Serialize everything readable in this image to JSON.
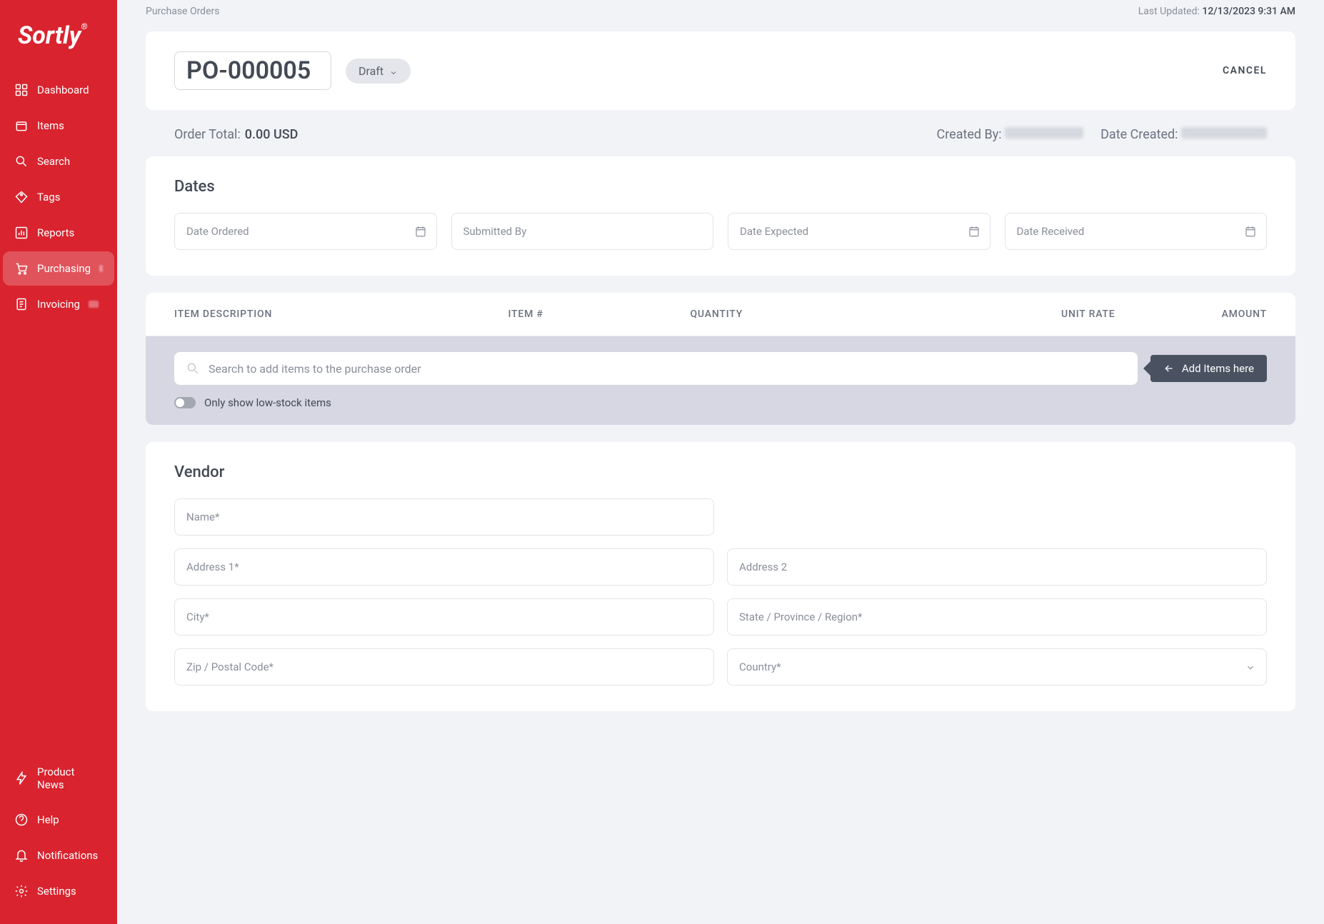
{
  "brand": "Sortly",
  "sidebar": {
    "top": [
      {
        "label": "Dashboard",
        "icon": "dashboard"
      },
      {
        "label": "Items",
        "icon": "box"
      },
      {
        "label": "Search",
        "icon": "search"
      },
      {
        "label": "Tags",
        "icon": "tag"
      },
      {
        "label": "Reports",
        "icon": "bar-chart"
      },
      {
        "label": "Purchasing",
        "icon": "cart",
        "active": true,
        "badge": true
      },
      {
        "label": "Invoicing",
        "icon": "document",
        "badge": true
      }
    ],
    "bottom": [
      {
        "label": "Product News",
        "icon": "bolt"
      },
      {
        "label": "Help",
        "icon": "help"
      },
      {
        "label": "Notifications",
        "icon": "bell"
      },
      {
        "label": "Settings",
        "icon": "gear"
      }
    ]
  },
  "breadcrumb": "Purchase Orders",
  "last_updated_label": "Last Updated: ",
  "last_updated_value": "12/13/2023 9:31 AM",
  "po_number": "PO-000005",
  "status": "Draft",
  "cancel_label": "CANCEL",
  "order_total_label": "Order Total:",
  "order_total_value": "0.00 USD",
  "created_by_label": "Created By:",
  "date_created_label": "Date Created:",
  "dates": {
    "title": "Dates",
    "date_ordered_ph": "Date Ordered",
    "submitted_by_ph": "Submitted By",
    "date_expected_ph": "Date Expected",
    "date_received_ph": "Date Received"
  },
  "items_table": {
    "col_desc": "ITEM DESCRIPTION",
    "col_num": "ITEM #",
    "col_qty": "QUANTITY",
    "col_rate": "UNIT RATE",
    "col_amount": "AMOUNT",
    "search_ph": "Search to add items to the purchase order",
    "add_items_label": "Add Items here",
    "low_stock_label": "Only show low-stock items"
  },
  "vendor": {
    "title": "Vendor",
    "name_ph": "Name*",
    "addr1_ph": "Address 1*",
    "addr2_ph": "Address 2",
    "city_ph": "City*",
    "state_ph": "State / Province / Region*",
    "zip_ph": "Zip / Postal Code*",
    "country_ph": "Country*"
  }
}
